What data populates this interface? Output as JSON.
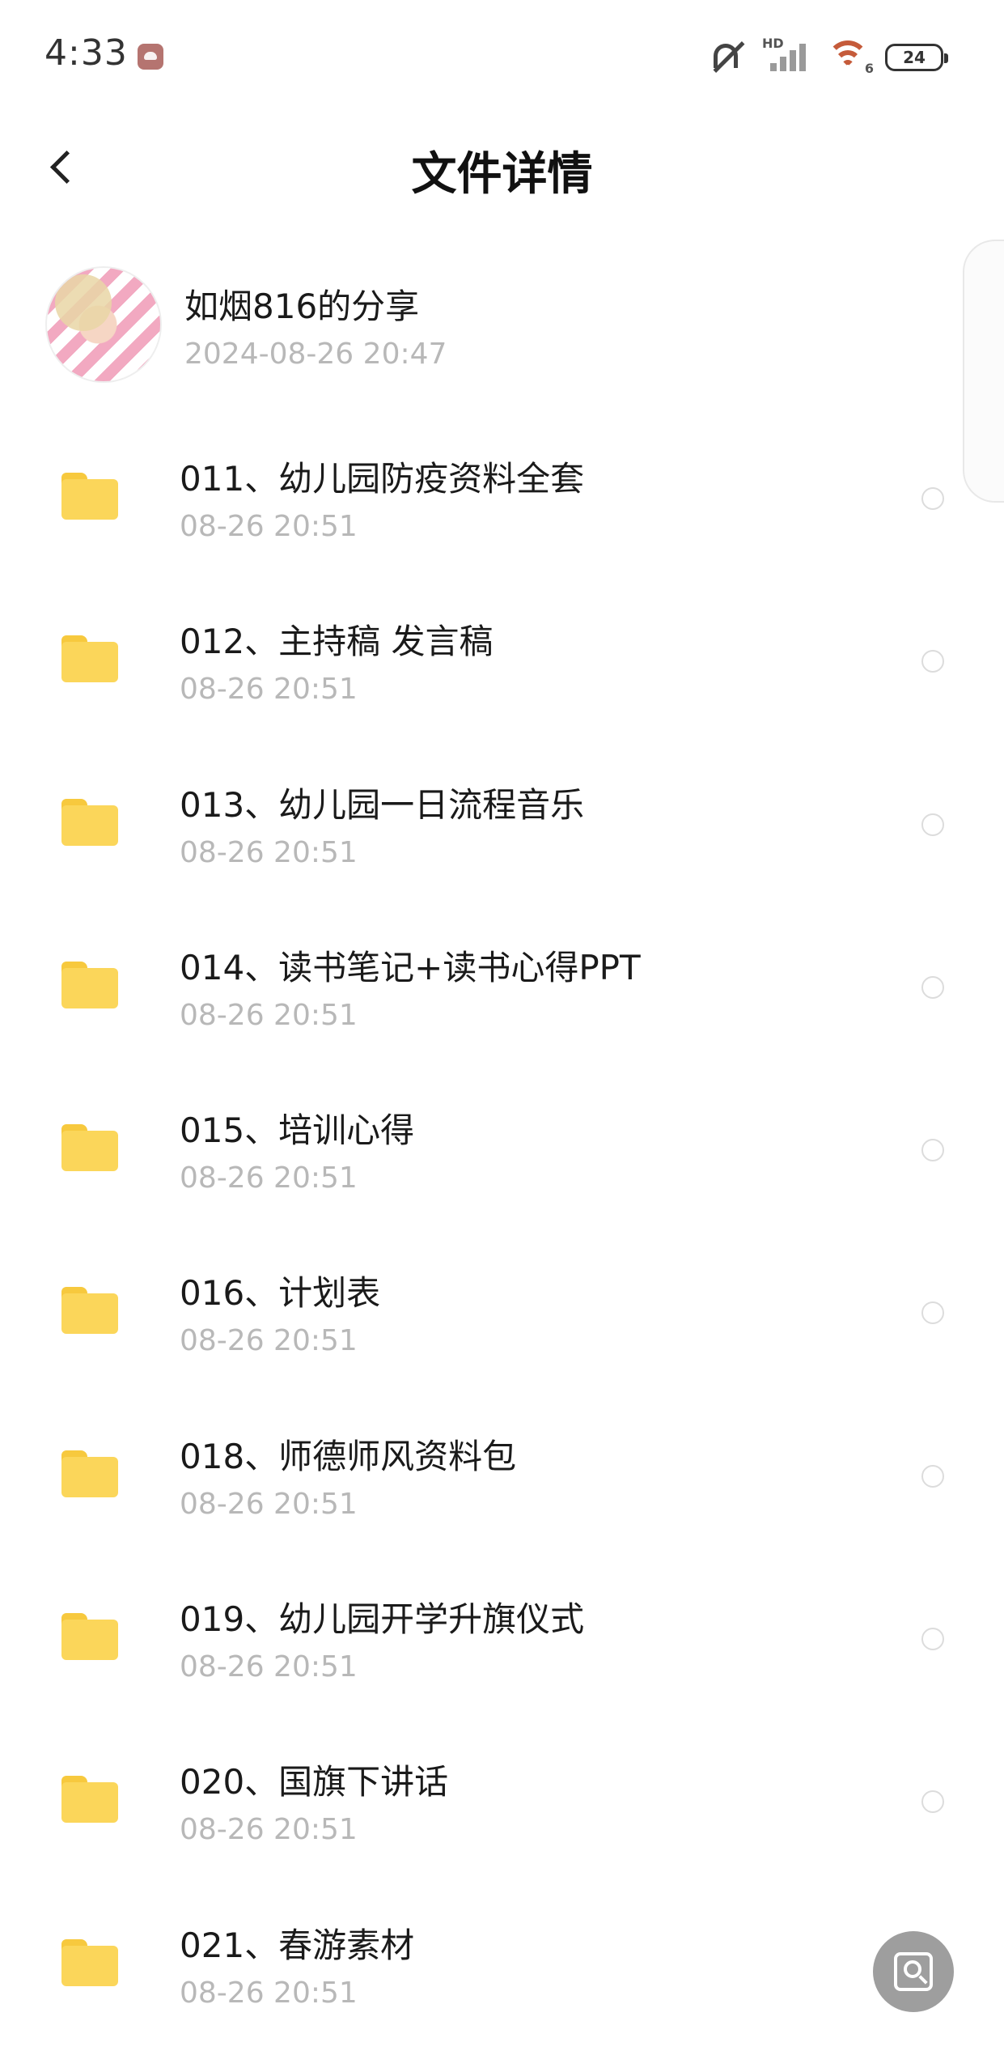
{
  "status_bar": {
    "time": "4:33",
    "signal_label": "HD",
    "wifi_label": "6",
    "battery": "24"
  },
  "header": {
    "title": "文件详情"
  },
  "share": {
    "owner_name": "如烟816的分享",
    "datetime": "2024-08-26  20:47"
  },
  "files": [
    {
      "name": "011、幼儿园防疫资料全套",
      "date": "08-26  20:51"
    },
    {
      "name": "012、主持稿 发言稿",
      "date": "08-26  20:51"
    },
    {
      "name": "013、幼儿园一日流程音乐",
      "date": "08-26  20:51"
    },
    {
      "name": "014、读书笔记+读书心得PPT",
      "date": "08-26  20:51"
    },
    {
      "name": "015、培训心得",
      "date": "08-26  20:51"
    },
    {
      "name": "016、计划表",
      "date": "08-26  20:51"
    },
    {
      "name": "018、师德师风资料包",
      "date": "08-26  20:51"
    },
    {
      "name": "019、幼儿园开学升旗仪式",
      "date": "08-26  20:51"
    },
    {
      "name": "020、国旗下讲话",
      "date": "08-26  20:51"
    },
    {
      "name": "021、春游素材",
      "date": "08-26  20:51"
    }
  ],
  "icons": {
    "folder": "folder-icon",
    "select": "radio-unchecked-icon",
    "scan": "scan-search-icon"
  },
  "colors": {
    "folder": "#fbd65a",
    "secondary_text": "#b8b8b8",
    "fab": "#9e9e9e"
  }
}
